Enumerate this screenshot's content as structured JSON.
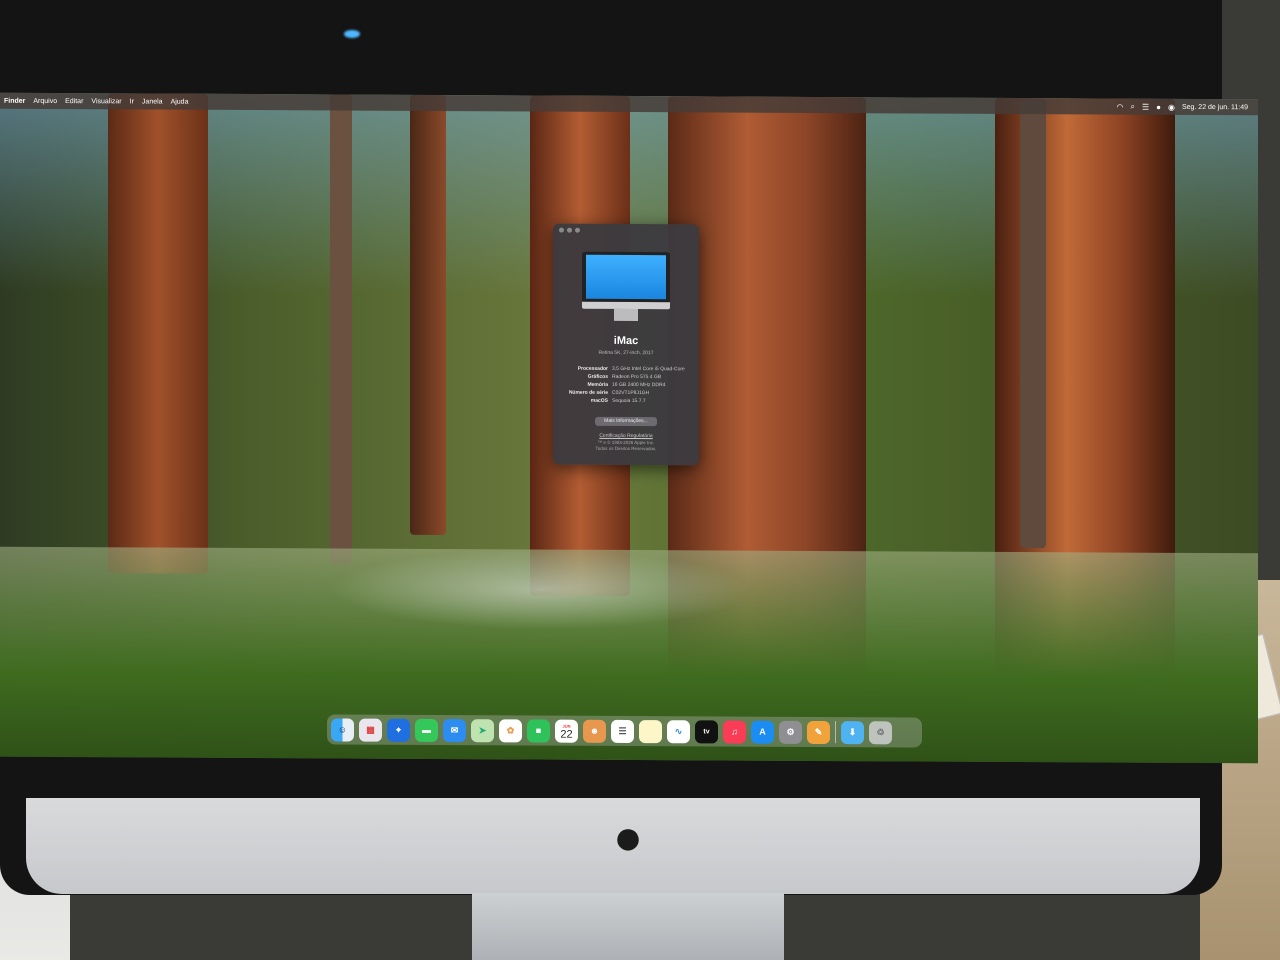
{
  "menubar": {
    "app_name": "Finder",
    "items": [
      "Arquivo",
      "Editar",
      "Visualizar",
      "Ir",
      "Janela",
      "Ajuda"
    ],
    "datetime": "Seg. 22 de jun.  11:49"
  },
  "about_window": {
    "model": "iMac",
    "submodel": "Retina 5K, 27-inch, 2017",
    "specs": [
      {
        "label": "Processador",
        "value": "3,5 GHz Intel Core i5 Quad-Core"
      },
      {
        "label": "Gráficos",
        "value": "Radeon Pro 575 4 GB"
      },
      {
        "label": "Memória",
        "value": "16 GB 2400 MHz DDR4"
      },
      {
        "label": "Número de série",
        "value": "C02VT1P8J1GH"
      },
      {
        "label": "macOS",
        "value": "Sequoia 15.7.7"
      }
    ],
    "more_info_button": "Mais Informações...",
    "certification_link": "Certificação Regulatória",
    "copyright_line1": "™ e © 1983-2026 Apple Inc.",
    "copyright_line2": "Todos os Direitos Reservados."
  },
  "dock": {
    "calendar_day": "22",
    "calendar_month": "JUN",
    "tv_label": "tv",
    "icons": [
      "finder-icon",
      "launchpad-icon",
      "safari-icon",
      "messages-icon",
      "mail-icon",
      "maps-icon",
      "photos-icon",
      "facetime-icon",
      "calendar-icon",
      "contacts-icon",
      "reminders-icon",
      "notes-icon",
      "freeform-icon",
      "tv-icon",
      "music-icon",
      "app-store-icon",
      "system-settings-icon",
      "pages-icon",
      "downloads-folder-icon",
      "trash-icon"
    ]
  }
}
